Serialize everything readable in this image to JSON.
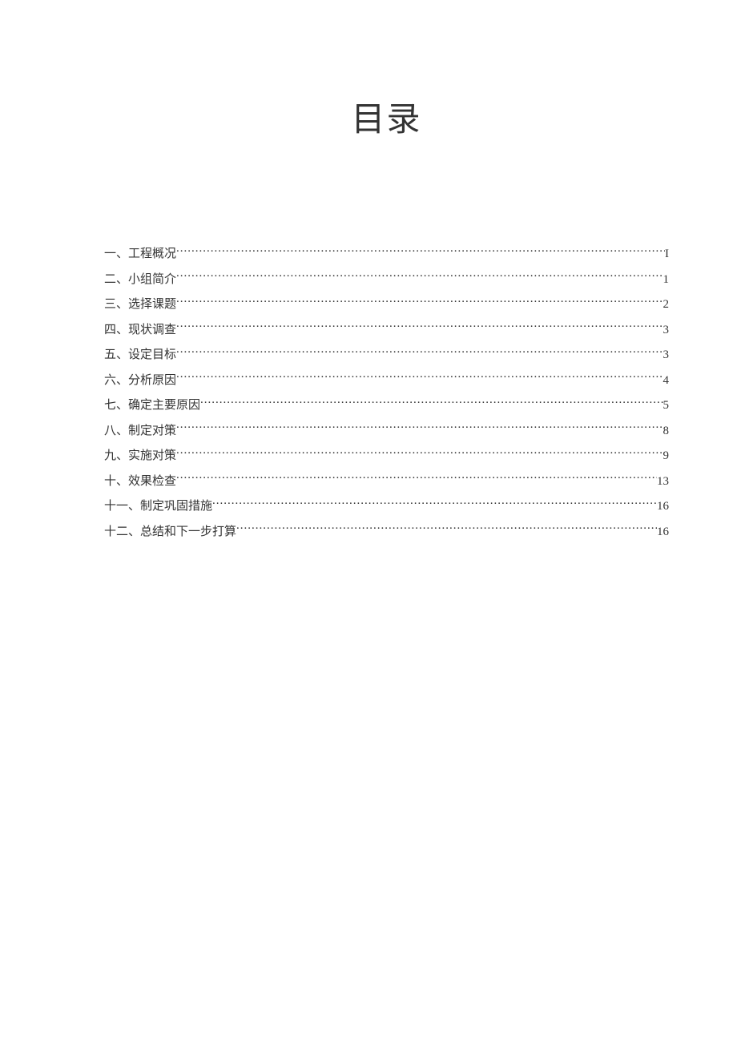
{
  "title": "目录",
  "toc": [
    {
      "label": "一、工程概况",
      "page": "I"
    },
    {
      "label": "二、小组简介",
      "page": "1"
    },
    {
      "label": "三、选择课题",
      "page": "2"
    },
    {
      "label": "四、现状调查",
      "page": "3"
    },
    {
      "label": "五、设定目标",
      "page": "3"
    },
    {
      "label": "六、分析原因",
      "page": "4"
    },
    {
      "label": "七、确定主要原因",
      "page": "5"
    },
    {
      "label": "八、制定对策",
      "page": "8"
    },
    {
      "label": "九、实施对策",
      "page": "9"
    },
    {
      "label": "十、效果检查",
      "page": "13"
    },
    {
      "label": "十一、制定巩固措施",
      "page": "16"
    },
    {
      "label": "十二、总结和下一步打算",
      "page": "16"
    }
  ]
}
